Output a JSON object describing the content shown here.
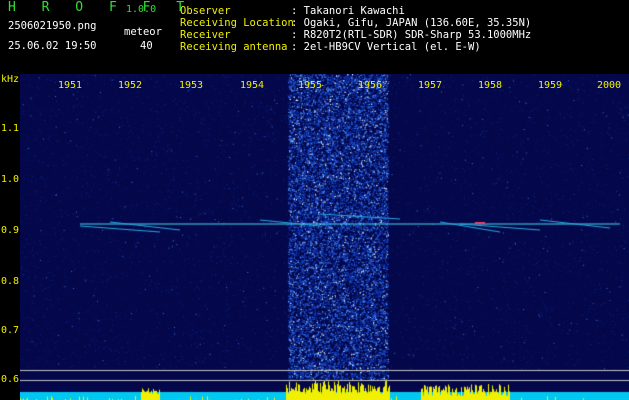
{
  "app": {
    "name": "H R O F F T",
    "version": "1.0.0"
  },
  "file": {
    "name": "2506021950.png",
    "datetime": "25.06.02 19:50"
  },
  "meteor": {
    "label": "meteor",
    "count": "40"
  },
  "info": [
    {
      "key": "Observer",
      "value": ": Takanori Kawachi"
    },
    {
      "key": "Receiving Location",
      "value": ": Ogaki, Gifu, JAPAN (136.60E, 35.35N)"
    },
    {
      "key": "Receiver",
      "value": ": R820T2(RTL-SDR) SDR-Sharp 53.1000MHz"
    },
    {
      "key": "Receiving antenna",
      "value": ": 2el-HB9CV Vertical (el. E-W)"
    }
  ],
  "axis": {
    "y_unit": "kHz",
    "x_ticks": [
      "1951",
      "1952",
      "1953",
      "1954",
      "1955",
      "1956",
      "1957",
      "1958",
      "1959",
      "2000"
    ],
    "y_ticks": [
      "1.1",
      "1.0",
      "0.9",
      "0.8",
      "0.7",
      "0.6"
    ]
  },
  "colors": {
    "bg": "#000000",
    "spectrum_bg": "#04084a",
    "label": "#f0f000",
    "title": "#30e030",
    "text": "#ffffff",
    "signal": "#40d8f0"
  }
}
